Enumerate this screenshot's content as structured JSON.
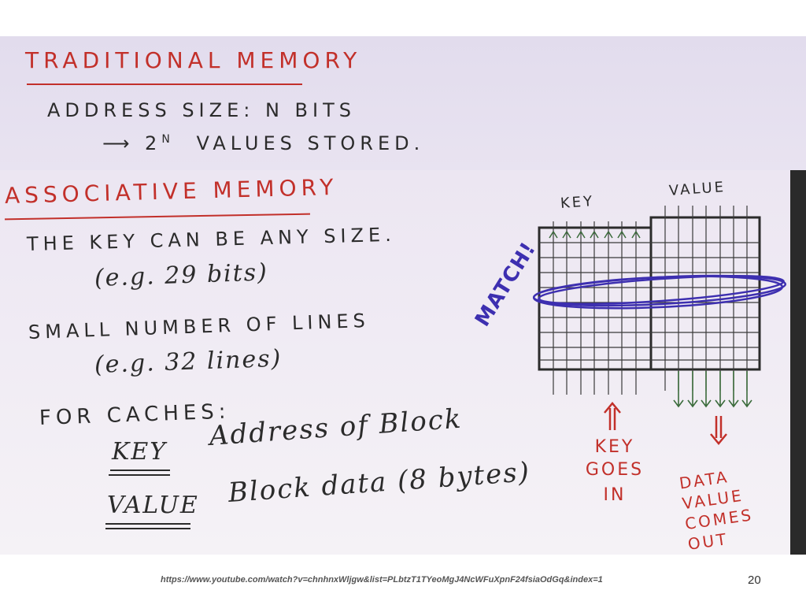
{
  "traditional": {
    "heading": "TRADITIONAL MEMORY",
    "line1": "ADDRESS SIZE: N BITS",
    "line2_arrow": "⟶ 2",
    "line2_sup": "N",
    "line2_rest": "VALUES STORED."
  },
  "associative": {
    "heading": "ASSOCIATIVE MEMORY",
    "key_any_size": "THE KEY CAN BE ANY SIZE.",
    "key_example": "(e.g. 29 bits)",
    "small_lines": "SMALL NUMBER OF LINES",
    "lines_example": "(e.g. 32 lines)",
    "for_caches": "FOR CACHES:",
    "key_label": "KEY",
    "key_value": "Address of Block",
    "value_label": "VALUE",
    "value_value": "Block data (8 bytes)"
  },
  "diagram": {
    "key_label": "KEY",
    "value_label": "VALUE",
    "match_label": "MATCH!",
    "key_goes_in": [
      "KEY",
      "GOES",
      "IN"
    ],
    "data_value_out": [
      "DATA",
      "VALUE",
      "COMES",
      "OUT"
    ],
    "colors": {
      "red": "#c2302a",
      "blue": "#3d2fb0",
      "ink": "#2b2b2b",
      "arrow_green": "#3b6b3b"
    }
  },
  "footer": {
    "url": "https://www.youtube.com/watch?v=chnhnxWljgw&list=PLbtzT1TYeoMgJ4NcWFuXpnF24fsiaOdGq&index=1",
    "slide_number": "20"
  }
}
